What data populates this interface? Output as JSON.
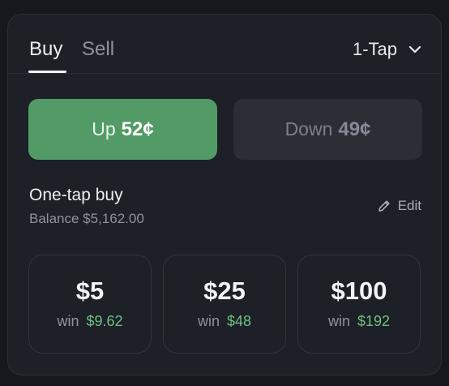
{
  "tabs": {
    "buy": "Buy",
    "sell": "Sell",
    "active": "Buy"
  },
  "mode": {
    "label": "1-Tap",
    "icon": "chevron-down-icon"
  },
  "outcomes": {
    "up": {
      "label": "Up",
      "price": "52¢",
      "color": "#529b66",
      "selected": true
    },
    "down": {
      "label": "Down",
      "price": "49¢",
      "color": "#2b2e35",
      "selected": false
    }
  },
  "one_tap": {
    "title": "One-tap buy",
    "balance": "Balance $5,162.00",
    "edit_label": "Edit",
    "edit_icon": "pencil-icon"
  },
  "amounts": [
    {
      "value": "$5",
      "win_label": "win",
      "payout": "$9.62"
    },
    {
      "value": "$25",
      "win_label": "win",
      "payout": "$48"
    },
    {
      "value": "$100",
      "win_label": "win",
      "payout": "$192"
    }
  ],
  "colors": {
    "accent_green": "#529b66",
    "payout_green": "#6fbf85",
    "background": "#1d2026"
  }
}
